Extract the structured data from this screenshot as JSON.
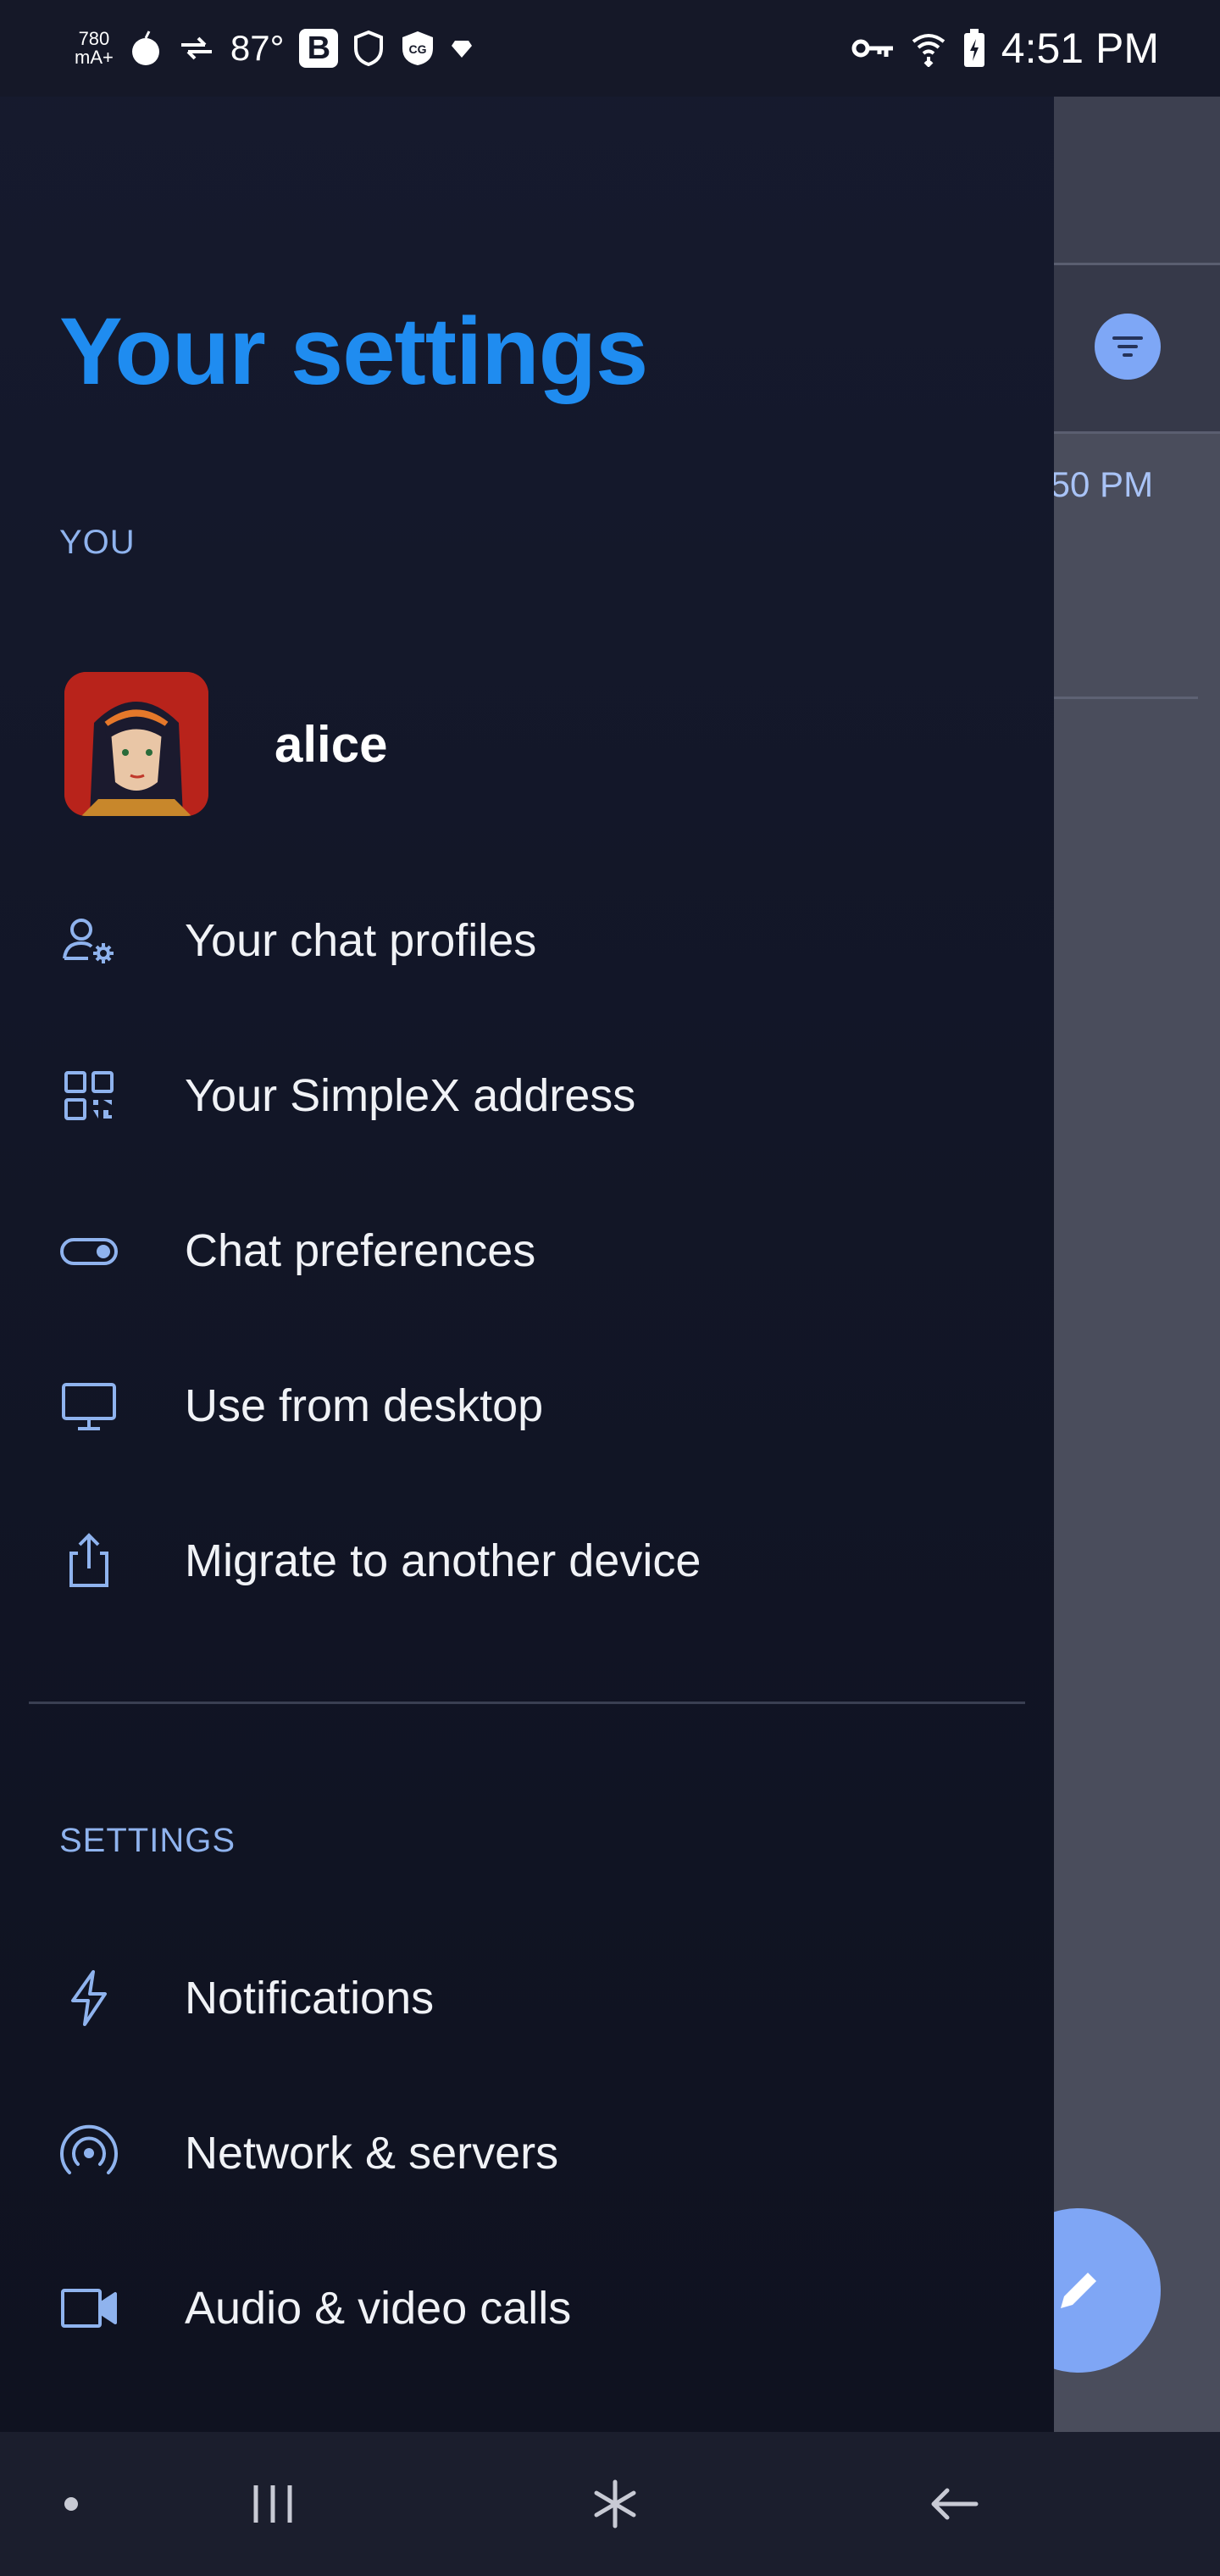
{
  "status_bar": {
    "left_counter": "780",
    "left_counter_unit": "mA+",
    "temperature": "87°",
    "badge_letter": "B",
    "time": "4:51 PM"
  },
  "background": {
    "chat_time": ":50 PM"
  },
  "drawer": {
    "title": "Your settings",
    "you_section": {
      "label": "YOU",
      "profile_name": "alice",
      "items": [
        {
          "label": "Your chat profiles",
          "icon": "user-settings-icon"
        },
        {
          "label": "Your SimpleX address",
          "icon": "qr-code-icon"
        },
        {
          "label": "Chat preferences",
          "icon": "toggle-icon"
        },
        {
          "label": "Use from desktop",
          "icon": "monitor-icon"
        },
        {
          "label": "Migrate to another device",
          "icon": "share-icon"
        }
      ]
    },
    "settings_section": {
      "label": "SETTINGS",
      "items": [
        {
          "label": "Notifications",
          "icon": "bolt-icon"
        },
        {
          "label": "Network & servers",
          "icon": "broadcast-icon"
        },
        {
          "label": "Audio & video calls",
          "icon": "video-camera-icon"
        }
      ]
    }
  },
  "colors": {
    "accent": "#1f8cf0",
    "icon": "#8fb3ee",
    "drawer_bg": "#141829",
    "fab": "#7fa6f5"
  }
}
